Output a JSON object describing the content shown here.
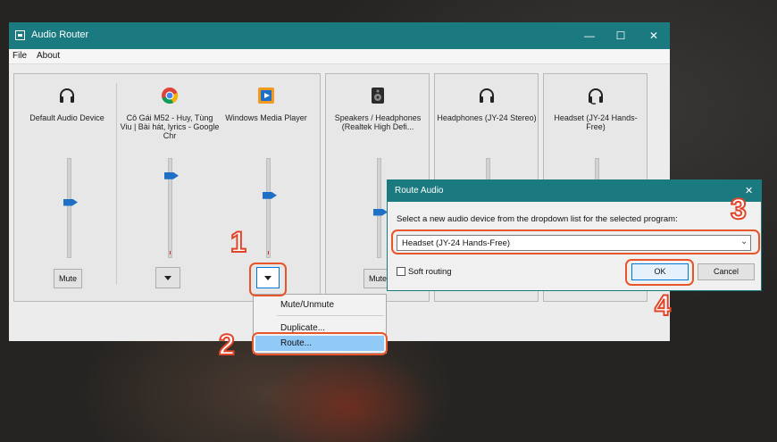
{
  "window": {
    "title": "Audio Router",
    "minimize": "—",
    "maximize": "☐",
    "close": "✕"
  },
  "menu": {
    "items": [
      "File",
      "About"
    ]
  },
  "devices": [
    {
      "icon": "headphones-icon",
      "label": "Default Audio Device",
      "button": "Mute",
      "level": 0.55
    },
    {
      "icon": "chrome-icon",
      "label": "Cô Gái M52 - Huy, Tùng Viu | Bài hát, lyrics - Google Chr",
      "button": "",
      "level": 0.82
    },
    {
      "icon": "media-player-icon",
      "label": "Windows Media Player",
      "button": "",
      "level": 0.62
    },
    {
      "icon": "speaker-icon",
      "label": "Speakers / Headphones (Realtek High Defi...",
      "button": "Mute",
      "level": 0.45
    },
    {
      "icon": "headphones-icon",
      "label": "Headphones (JY-24 Stereo)",
      "button": "",
      "level": 0.5
    },
    {
      "icon": "headset-icon",
      "label": "Headset (JY-24 Hands-Free)",
      "button": "",
      "level": 0.5
    }
  ],
  "context_menu": {
    "items": [
      "Mute/Unmute",
      "Duplicate...",
      "Route..."
    ]
  },
  "dialog": {
    "title": "Route Audio",
    "close": "✕",
    "instruction": "Select a new audio device from the dropdown list for the selected program:",
    "selected_device": "Headset (JY-24 Hands-Free)",
    "soft_routing_label": "Soft routing",
    "soft_routing_checked": false,
    "ok": "OK",
    "cancel": "Cancel"
  },
  "annotations": {
    "step1": "1",
    "step2": "2",
    "step3": "3",
    "step4": "4",
    "color": "#e0452a"
  }
}
